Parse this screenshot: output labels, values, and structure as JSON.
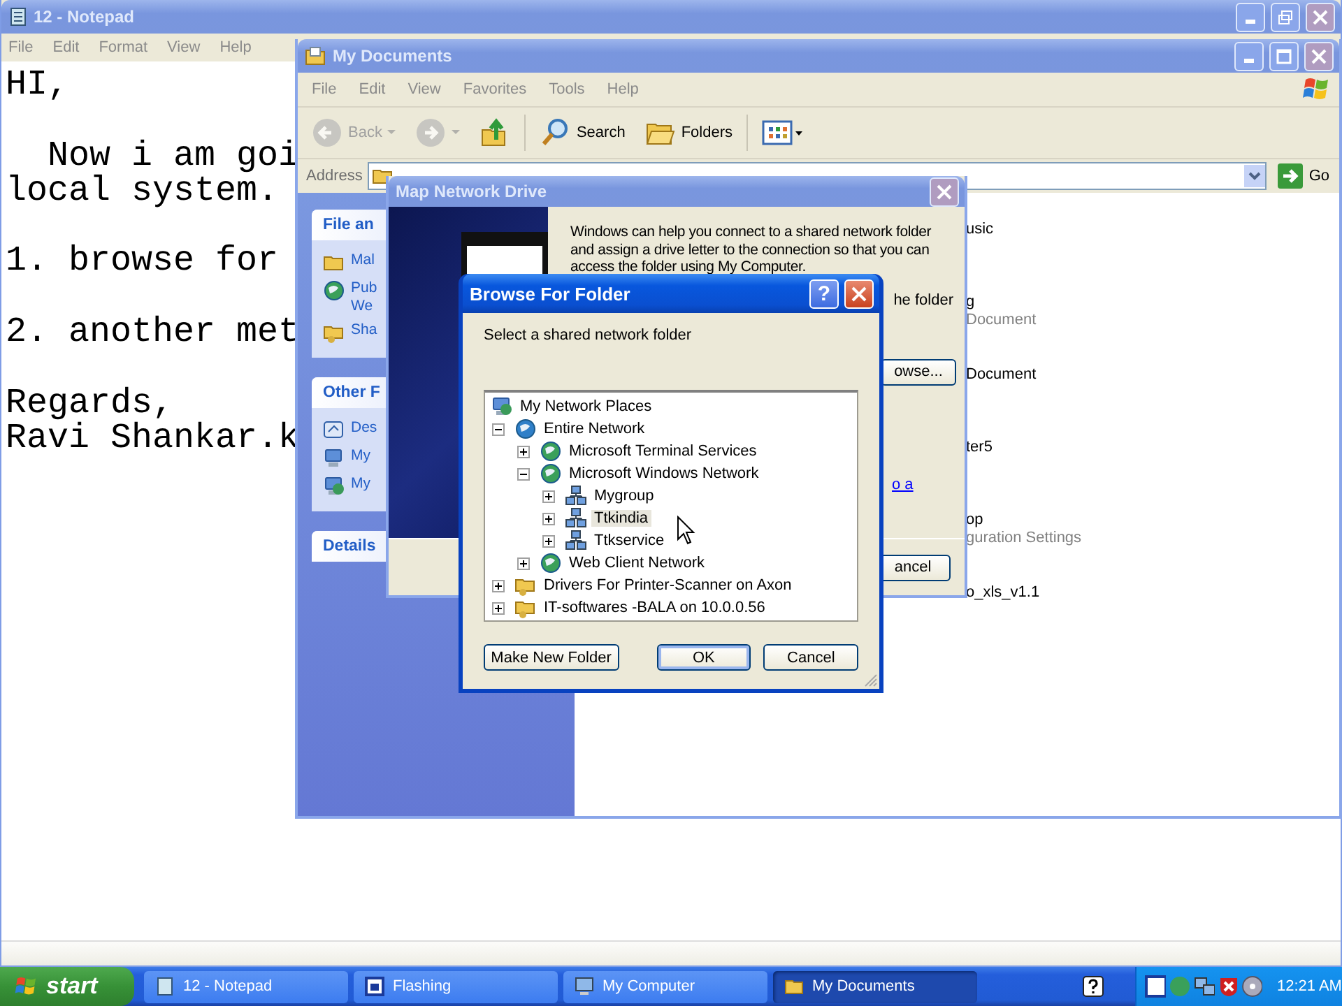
{
  "notepad": {
    "title": "12 - Notepad",
    "menu": [
      "File",
      "Edit",
      "Format",
      "View",
      "Help"
    ],
    "paragraphs": [
      [
        "HI,"
      ],
      [
        "  Now i am goi",
        "local system."
      ],
      [
        "1. browse for"
      ],
      [
        "2. another met"
      ],
      [
        "Regards,",
        "Ravi Shankar.k"
      ]
    ]
  },
  "explorer": {
    "title": "My Documents",
    "menu": [
      "File",
      "Edit",
      "View",
      "Favorites",
      "Tools",
      "Help"
    ],
    "toolbar": [
      {
        "kind": "back",
        "label": "Back",
        "disabled": true
      },
      {
        "kind": "forward",
        "disabled": true
      },
      {
        "kind": "up",
        "disabled": false
      },
      {
        "kind": "search",
        "label": "Search",
        "disabled": false
      },
      {
        "kind": "folders",
        "label": "Folders",
        "disabled": false
      },
      {
        "kind": "views",
        "disabled": false
      }
    ],
    "address_label": "Address",
    "go": "Go",
    "task_sections": [
      {
        "title": "File an",
        "items": [
          {
            "kind": "folder",
            "lines": [
              "Mal"
            ]
          },
          {
            "kind": "globe",
            "lines": [
              "Pub",
              "We"
            ]
          },
          {
            "kind": "share",
            "lines": [
              "Sha"
            ]
          }
        ]
      },
      {
        "title": "Other F",
        "items": [
          {
            "kind": "desktop",
            "lines": [
              "Des"
            ]
          },
          {
            "kind": "computer",
            "lines": [
              "My"
            ]
          },
          {
            "kind": "network",
            "lines": [
              "My"
            ]
          }
        ]
      },
      {
        "title": "Details"
      }
    ],
    "files": [
      {
        "lines": [
          "usic"
        ]
      },
      {
        "lines": [
          "g",
          "Document"
        ]
      },
      {
        "lines": [
          "Document"
        ]
      },
      {
        "lines": [
          "ter5"
        ]
      },
      {
        "lines": [
          "op",
          "guration Settings"
        ]
      },
      {
        "lines": [
          "o_xls_v1.1"
        ]
      }
    ]
  },
  "map_drive": {
    "title": "Map Network Drive",
    "description": "Windows can help you connect to a shared network folder and assign a drive letter to the connection so that you can access the folder using My Computer.",
    "fragment": "he folder",
    "browse_button": "owse...",
    "link": "o a",
    "cancel_button": "ancel"
  },
  "browse": {
    "title": "Browse For Folder",
    "help_button": "?",
    "prompt": "Select a shared network folder",
    "tree": [
      {
        "label": "My Network Places",
        "kind": "places",
        "selected": false,
        "children": [
          {
            "label": "Entire Network",
            "kind": "world",
            "expanded": true,
            "selected": false,
            "children": [
              {
                "label": "Microsoft Terminal Services",
                "kind": "globe",
                "expanded": false,
                "selected": false
              },
              {
                "label": "Microsoft Windows Network",
                "kind": "globe",
                "expanded": true,
                "selected": false,
                "children": [
                  {
                    "label": "Mygroup",
                    "kind": "workgroup",
                    "expanded": false,
                    "selected": false
                  },
                  {
                    "label": "Ttkindia",
                    "kind": "workgroup",
                    "expanded": false,
                    "selected": true
                  },
                  {
                    "label": "Ttkservice",
                    "kind": "workgroup",
                    "expanded": false,
                    "selected": false
                  }
                ]
              },
              {
                "label": "Web Client Network",
                "kind": "globe",
                "expanded": false,
                "selected": false
              }
            ]
          },
          {
            "label": "Drivers For Printer-Scanner on Axon",
            "kind": "share",
            "expanded": false,
            "selected": false
          },
          {
            "label": "IT-softwares -BALA on 10.0.0.56",
            "kind": "share",
            "expanded": false,
            "selected": false
          }
        ]
      }
    ],
    "buttons": [
      "Make New Folder",
      "OK",
      "Cancel"
    ]
  },
  "taskbar": {
    "start": "start",
    "tasks": [
      {
        "label": "12 - Notepad",
        "kind": "notepad",
        "selected": false
      },
      {
        "label": "Flashing",
        "kind": "app",
        "selected": false
      },
      {
        "label": "My Computer",
        "kind": "computer",
        "selected": false
      },
      {
        "label": "My Documents",
        "kind": "documents",
        "selected": true
      }
    ],
    "clock": "12:21 AM"
  }
}
